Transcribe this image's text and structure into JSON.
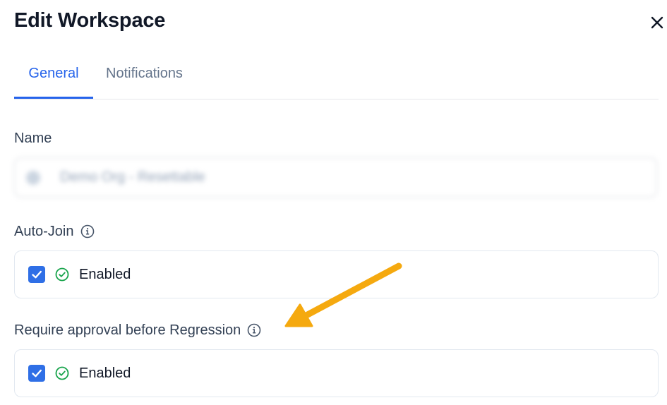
{
  "dialog": {
    "title": "Edit Workspace",
    "close_icon": "close-icon"
  },
  "tabs": [
    {
      "label": "General",
      "active": true
    },
    {
      "label": "Notifications",
      "active": false
    }
  ],
  "fields": {
    "name": {
      "label": "Name",
      "value": "Demo Org - Resettable"
    },
    "auto_join": {
      "label": "Auto-Join",
      "info_icon": "info-icon",
      "checked": true,
      "status_icon": "check-circle-icon",
      "status_text": "Enabled"
    },
    "require_approval": {
      "label": "Require approval before Regression",
      "info_icon": "info-icon",
      "checked": true,
      "status_icon": "check-circle-icon",
      "status_text": "Enabled"
    }
  },
  "colors": {
    "accent": "#2563eb",
    "checkbox": "#2f6fe6",
    "success": "#16a34a",
    "annotation_arrow": "#f5a90f"
  }
}
